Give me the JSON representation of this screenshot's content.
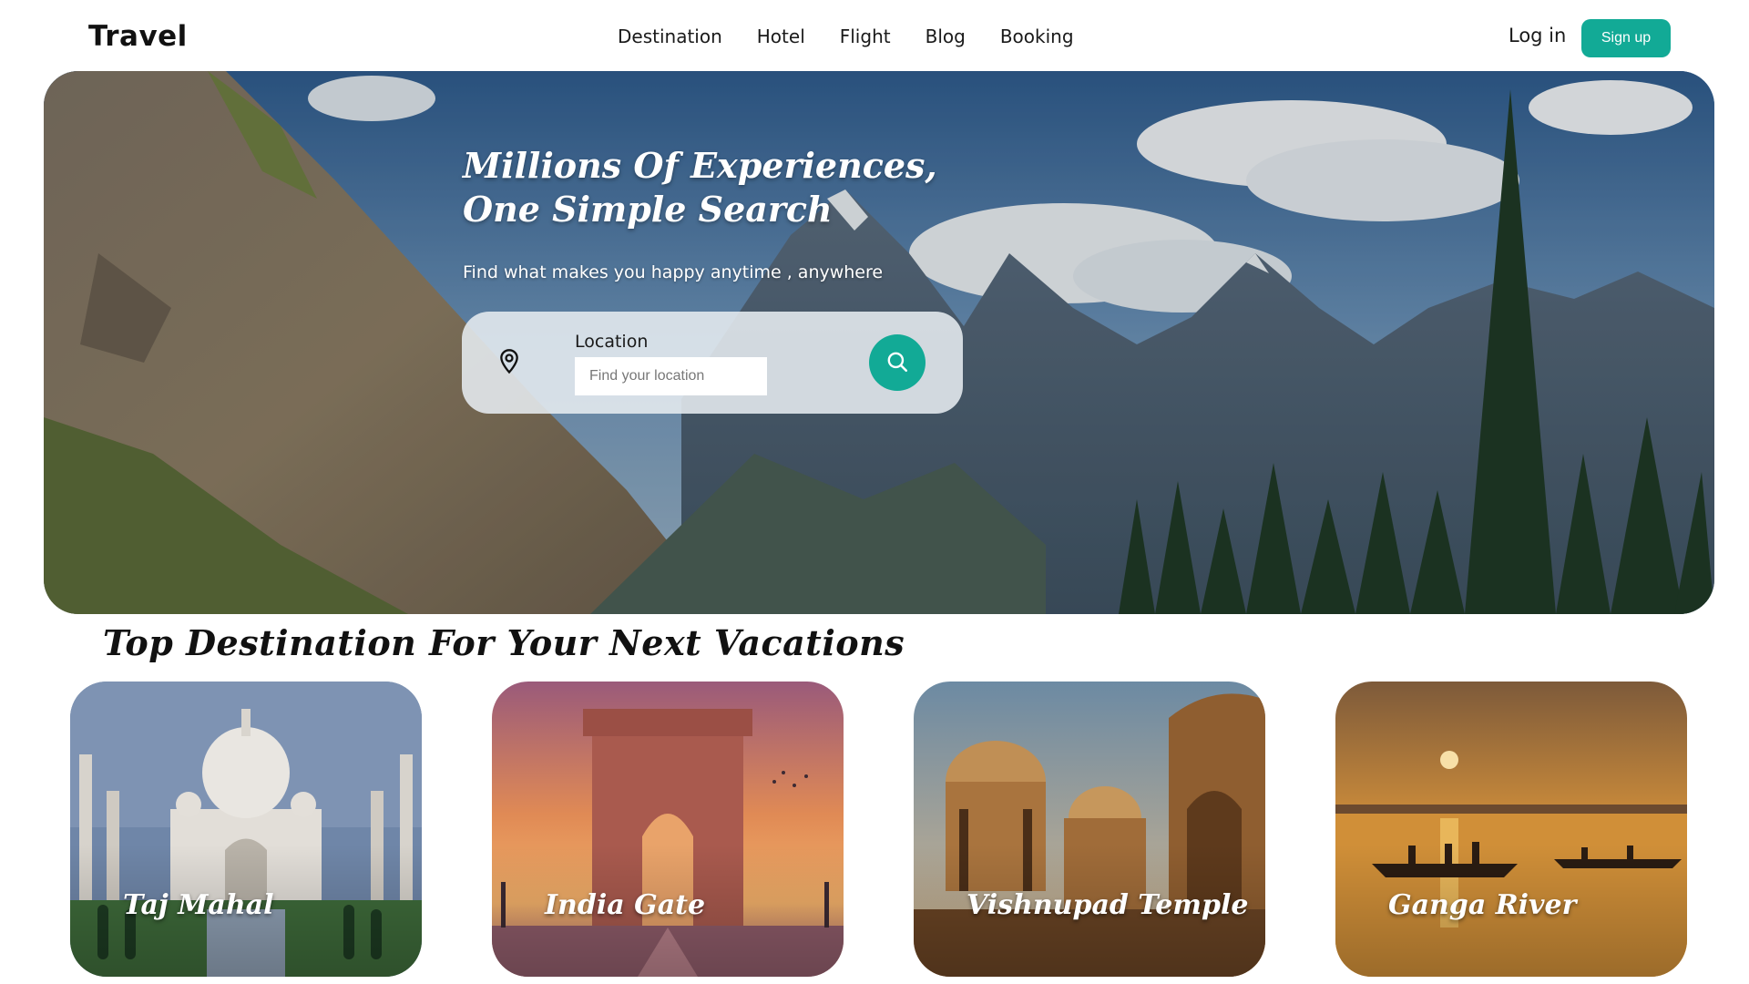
{
  "header": {
    "logo": "Travel",
    "nav": [
      "Destination",
      "Hotel",
      "Flight",
      "Blog",
      "Booking"
    ],
    "login_label": "Log in",
    "signup_label": "Sign up"
  },
  "hero": {
    "title_line1": "Millions Of Experiences,",
    "title_line2": "One Simple Search",
    "subtitle": "Find what makes you happy anytime , anywhere",
    "search": {
      "label": "Location",
      "placeholder": "Find your location",
      "value": ""
    }
  },
  "destinations": {
    "title": "Top Destination For Your Next Vacations",
    "items": [
      {
        "name": "Taj Mahal"
      },
      {
        "name": "India Gate"
      },
      {
        "name": "Vishnupad Temple"
      },
      {
        "name": "Ganga River"
      }
    ]
  },
  "colors": {
    "accent": "#12aa96",
    "text": "#111111",
    "background": "#ffffff"
  },
  "icons": {
    "location": "map-pin-icon",
    "search": "search-icon"
  }
}
